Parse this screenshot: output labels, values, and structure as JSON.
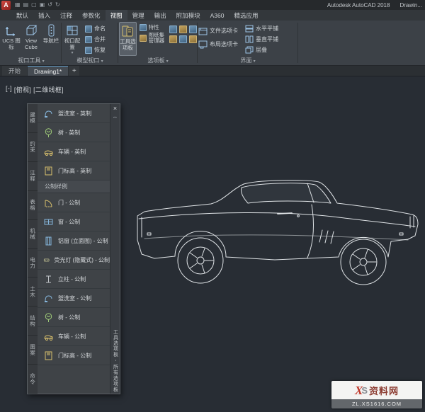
{
  "titlebar": {
    "logo": "A",
    "quick_icons": [
      "menu-grid-icon",
      "new-icon",
      "open-icon",
      "save-icon",
      "undo-icon",
      "redo-icon"
    ],
    "app_title": "Autodesk AutoCAD 2018",
    "doc_title": "Drawin..."
  },
  "ribbon": {
    "tabs": [
      {
        "label": "默认",
        "active": false
      },
      {
        "label": "插入",
        "active": false
      },
      {
        "label": "注释",
        "active": false
      },
      {
        "label": "参数化",
        "active": false
      },
      {
        "label": "视图",
        "active": true
      },
      {
        "label": "管理",
        "active": false
      },
      {
        "label": "输出",
        "active": false
      },
      {
        "label": "附加模块",
        "active": false
      },
      {
        "label": "A360",
        "active": false
      },
      {
        "label": "精选应用",
        "active": false
      }
    ],
    "panels": {
      "viewport_tools": {
        "label": "视口工具",
        "buttons": [
          {
            "label": "UCS 图标"
          },
          {
            "label": "View Cube"
          },
          {
            "label": "导航栏"
          }
        ]
      },
      "model_viewports": {
        "label": "模型视口",
        "big_button": "视口配置",
        "small_buttons": [
          "命名",
          "合并",
          "恢复"
        ]
      },
      "palettes": {
        "label": "选项板",
        "big_button": "工具选项板",
        "buttons": [
          "特性",
          "图纸集管理器"
        ]
      },
      "interface": {
        "label": "界面",
        "toggle_buttons": [
          "文件选项卡",
          "布局选项卡"
        ],
        "tile_buttons": [
          "水平平铺",
          "垂直平铺",
          "层叠"
        ]
      }
    }
  },
  "file_tabs": {
    "tabs": [
      {
        "label": "开始",
        "active": false
      },
      {
        "label": "Drawing1*",
        "active": true
      }
    ],
    "new_tab": "+"
  },
  "viewport_label": {
    "controls": "[-]",
    "view": "[俯视]",
    "visual_style": "[二维线框]"
  },
  "palette_window": {
    "title": "工具选项板 - 所有选项板",
    "group_tabs": [
      "建模",
      "约束",
      "注释",
      "表格",
      "机械",
      "电力",
      "土木",
      "结构",
      "图案",
      "命令"
    ],
    "items": [
      {
        "icon": "sink-icon",
        "label": "盥洗室 - 英制"
      },
      {
        "icon": "tree-icon",
        "label": "树 - 英制"
      },
      {
        "icon": "vehicle-icon",
        "label": "车辆 - 英制"
      },
      {
        "icon": "door-elevation-icon",
        "label": "门标高 - 英制"
      },
      {
        "header": "公制样例"
      },
      {
        "icon": "door-icon",
        "label": "门 - 公制"
      },
      {
        "icon": "window-icon",
        "label": "窗 - 公制"
      },
      {
        "icon": "aluminum-window-icon",
        "label": "铝窗 (立面图) - 公制"
      },
      {
        "icon": "fluorescent-light-icon",
        "label": "荧光灯 (隐藏式) - 公制"
      },
      {
        "icon": "column-icon",
        "label": "立柱 - 公制"
      },
      {
        "icon": "sink-icon",
        "label": "盥洗室 - 公制"
      },
      {
        "icon": "tree-icon",
        "label": "树 - 公制"
      },
      {
        "icon": "vehicle-icon",
        "label": "车辆 - 公制"
      },
      {
        "icon": "door-elevation-icon",
        "label": "门标高 - 公制"
      }
    ]
  },
  "watermark": {
    "logo_x": "X",
    "logo_s": "S",
    "brand": "资料网",
    "url": "ZL.XS1616.COM"
  },
  "colors": {
    "accent_blue": "#5f98c0",
    "icon_blue": "#86b7dd",
    "icon_yellow": "#d9c06c",
    "canvas": "#282d34",
    "line_white": "#dfe3e6",
    "watermark_red": "#b03a2e"
  }
}
